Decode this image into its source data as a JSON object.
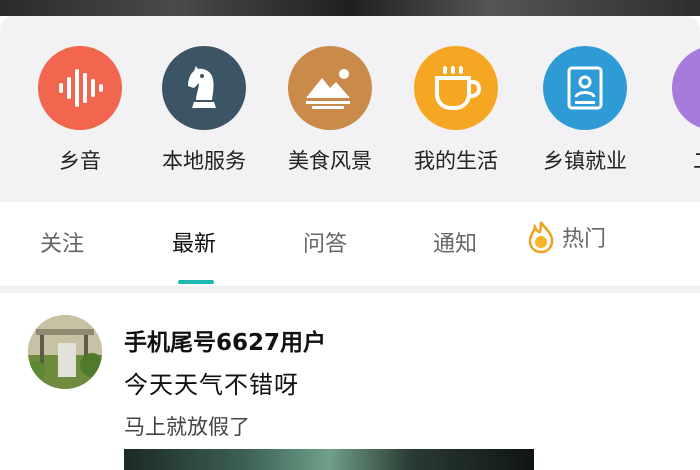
{
  "categories": [
    {
      "label": "乡音",
      "icon": "voice-wave-icon",
      "color": "#f2654f"
    },
    {
      "label": "本地服务",
      "icon": "chess-knight-icon",
      "color": "#3b5567"
    },
    {
      "label": "美食风景",
      "icon": "landscape-icon",
      "color": "#c98a4a"
    },
    {
      "label": "我的生活",
      "icon": "coffee-cup-icon",
      "color": "#f5a623"
    },
    {
      "label": "乡镇就业",
      "icon": "id-card-icon",
      "color": "#2f9bd6"
    },
    {
      "label": "二手",
      "icon": "lock-icon",
      "color": "#a77bdc"
    }
  ],
  "tabs": [
    {
      "label": "关注"
    },
    {
      "label": "最新",
      "active": true
    },
    {
      "label": "问答"
    },
    {
      "label": "通知"
    },
    {
      "label": "热门",
      "icon": "fire-icon"
    }
  ],
  "accent_color": "#1db8b0",
  "post": {
    "username": "手机尾号6627用户",
    "title": "今天天气不错呀",
    "body": "马上就放假了"
  }
}
